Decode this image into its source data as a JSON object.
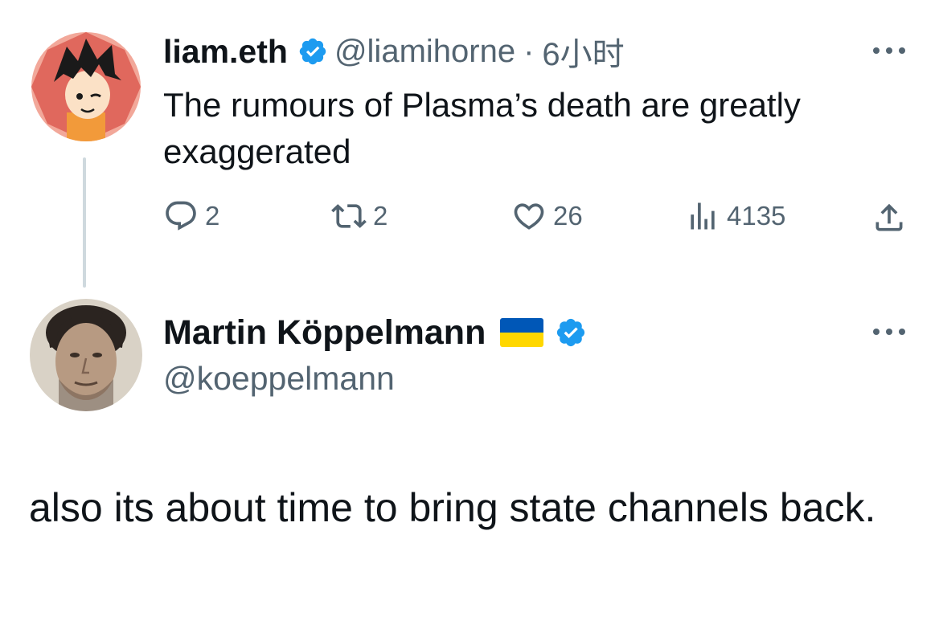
{
  "colors": {
    "text_primary": "#0f1419",
    "text_secondary": "#536471",
    "verified_blue": "#1d9bf0",
    "thread_line": "#cfd9de",
    "flag_blue": "#0057b7",
    "flag_yellow": "#ffd700"
  },
  "tweet1": {
    "name": "liam.eth",
    "handle": "@liamihorne",
    "separator": "·",
    "time": "6小时",
    "text": "The rumours of Plasma’s death are greatly exaggerated",
    "actions": {
      "replies": "2",
      "retweets": "2",
      "likes": "26",
      "views": "4135"
    },
    "icons": [
      "verified-badge-icon",
      "more-options-icon",
      "reply-icon",
      "retweet-icon",
      "like-icon",
      "views-icon",
      "share-icon"
    ]
  },
  "tweet2": {
    "name": "Martin Köppelmann",
    "flag_emoji": "ukraine-flag-icon",
    "handle": "@koeppelmann",
    "text": "also its about time to bring state channels back.",
    "icons": [
      "verified-badge-icon",
      "more-options-icon"
    ]
  }
}
